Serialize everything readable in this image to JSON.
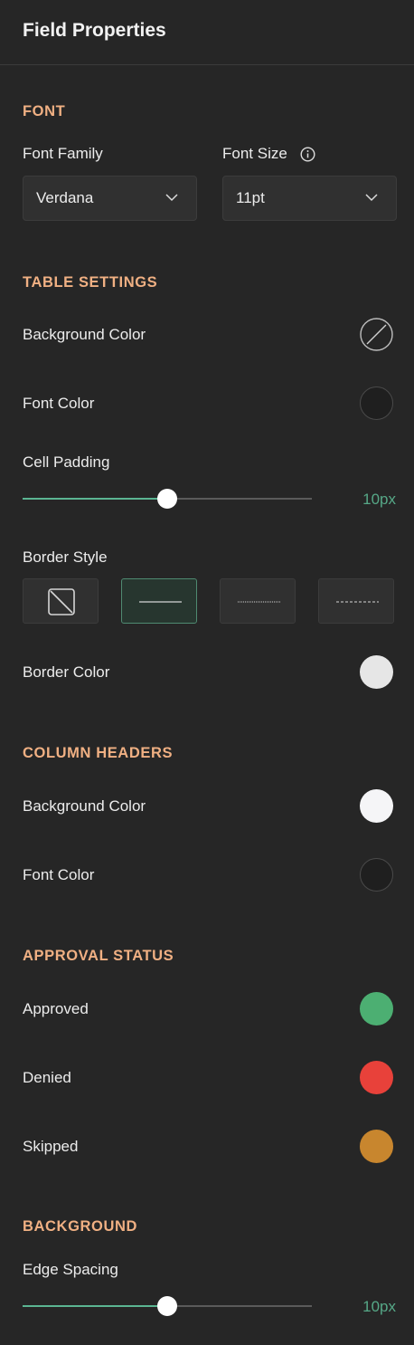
{
  "header": {
    "title": "Field Properties"
  },
  "font": {
    "section_title": "FONT",
    "family_label": "Font Family",
    "family_value": "Verdana",
    "size_label": "Font Size",
    "size_value": "11pt"
  },
  "table_settings": {
    "section_title": "TABLE SETTINGS",
    "background_color_label": "Background Color",
    "background_color": "none",
    "font_color_label": "Font Color",
    "font_color": "#1f1f1f",
    "cell_padding_label": "Cell Padding",
    "cell_padding_value": "10px",
    "cell_padding_fraction": 0.5,
    "border_style_label": "Border Style",
    "border_styles": [
      "none",
      "solid",
      "dotted",
      "dashed"
    ],
    "border_style_selected": "solid",
    "border_color_label": "Border Color",
    "border_color": "#e6e6e6"
  },
  "column_headers": {
    "section_title": "COLUMN HEADERS",
    "background_color_label": "Background Color",
    "background_color": "#f5f5f7",
    "font_color_label": "Font Color",
    "font_color": "#1f1f1f"
  },
  "approval_status": {
    "section_title": "APPROVAL STATUS",
    "approved_label": "Approved",
    "approved_color": "#4caf72",
    "denied_label": "Denied",
    "denied_color": "#e8413a",
    "skipped_label": "Skipped",
    "skipped_color": "#c8862e"
  },
  "background": {
    "section_title": "BACKGROUND",
    "edge_spacing_label": "Edge Spacing",
    "edge_spacing_value": "10px",
    "edge_spacing_fraction": 0.5
  },
  "theme": {
    "panel_bg": "#262626",
    "accent": "#5bb592",
    "section_title_color": "#f0b083"
  },
  "icons": {
    "chevron": "chevron-down-icon",
    "info": "info-icon",
    "no_color": "no-color-icon"
  }
}
